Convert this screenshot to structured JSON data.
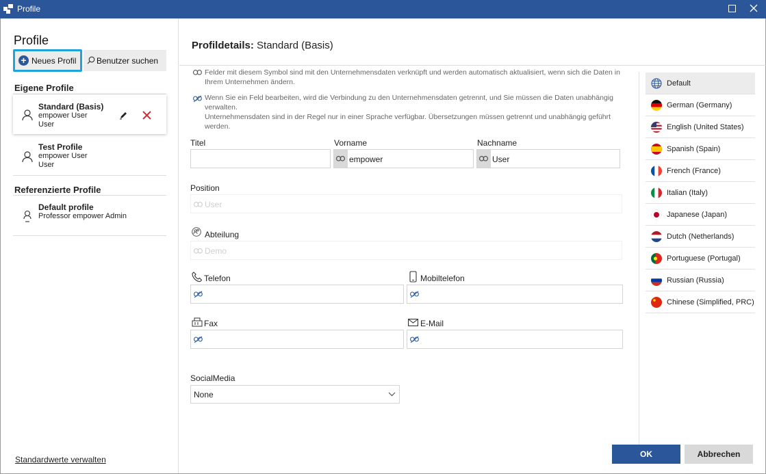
{
  "window": {
    "title": "Profile"
  },
  "left": {
    "heading": "Profile",
    "new_profile_label": "Neues Profil",
    "search_user_label": "Benutzer suchen",
    "own_profiles_title": "Eigene Profile",
    "own_profiles": [
      {
        "name": "Standard (Basis)",
        "line1": "empower User",
        "line2": "User"
      },
      {
        "name": "Test Profile",
        "line1": "empower User",
        "line2": "User"
      }
    ],
    "referenced_title": "Referenzierte Profile",
    "referenced_profiles": [
      {
        "name": "Default profile",
        "line1": "Professor empower Admin"
      }
    ],
    "manage_defaults": "Standardwerte verwalten"
  },
  "details": {
    "title_bold": "Profildetails:",
    "title_value": " Standard (Basis)",
    "info_linked": "Felder mit diesem Symbol sind mit den Unternehmensdaten verknüpft und werden automatisch aktualisiert, wenn sich die Daten in Ihrem Unternehmen ändern.",
    "info_unlinked_1": "Wenn Sie ein Feld bearbeiten, wird die Verbindung zu den Unternehmensdaten getrennt, und Sie müssen die Daten unabhängig verwalten.",
    "info_unlinked_2": "Unternehmensdaten sind in der Regel nur in einer Sprache verfügbar. Übersetzungen müssen getrennt und unabhängig geführt werden.",
    "fields": {
      "titel_label": "Titel",
      "titel_value": "",
      "vorname_label": "Vorname",
      "vorname_value": "empower",
      "nachname_label": "Nachname",
      "nachname_value": "User",
      "position_label": "Position",
      "position_placeholder": "User",
      "abteilung_label": "Abteilung",
      "abteilung_placeholder": "Demo",
      "telefon_label": "Telefon",
      "mobil_label": "Mobiltelefon",
      "fax_label": "Fax",
      "email_label": "E-Mail",
      "social_label": "SocialMedia",
      "social_value": "None"
    }
  },
  "languages": [
    {
      "label": "Default",
      "icon": "globe-icon",
      "selected": true
    },
    {
      "label": "German (Germany)",
      "icon": "flag-de-icon"
    },
    {
      "label": "English (United States)",
      "icon": "flag-us-icon"
    },
    {
      "label": "Spanish (Spain)",
      "icon": "flag-es-icon"
    },
    {
      "label": "French (France)",
      "icon": "flag-fr-icon"
    },
    {
      "label": "Italian (Italy)",
      "icon": "flag-it-icon"
    },
    {
      "label": "Japanese (Japan)",
      "icon": "flag-jp-icon"
    },
    {
      "label": "Dutch (Netherlands)",
      "icon": "flag-nl-icon"
    },
    {
      "label": "Portuguese (Portugal)",
      "icon": "flag-pt-icon"
    },
    {
      "label": "Russian (Russia)",
      "icon": "flag-ru-icon"
    },
    {
      "label": "Chinese (Simplified, PRC)",
      "icon": "flag-cn-icon"
    }
  ],
  "buttons": {
    "ok": "OK",
    "cancel": "Abbrechen"
  },
  "colors": {
    "accent": "#2b579a",
    "highlight": "#1fa3d8",
    "delete": "#e0292b"
  }
}
